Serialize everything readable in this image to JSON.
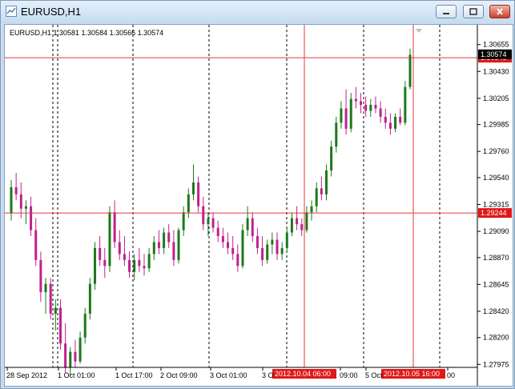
{
  "window": {
    "title": "EURUSD,H1",
    "minimize_icon": "minimize-icon",
    "maximize_icon": "maximize-icon",
    "close_icon": "close-icon"
  },
  "chart_data": {
    "type": "candlestick",
    "header": "EURUSD,H1  1.30581 1.30584 1.30566 1.30574",
    "y_range": [
      1.2795,
      1.307
    ],
    "y_ticks": [
      "1.30655",
      "1.30430",
      "1.30205",
      "1.29985",
      "1.29760",
      "1.29540",
      "1.29315",
      "1.29090",
      "1.28870",
      "1.28645",
      "1.28420",
      "1.28200",
      "1.27975"
    ],
    "x_labels": [
      "28 Sep 2012",
      "1 Oct 01:00",
      "1 Oct 17:00",
      "2 Oct 09:00",
      "3 Oct 01:00",
      "3 O",
      "09:00",
      "5 Oct",
      "00"
    ],
    "horizontal_lines": [
      {
        "price": 1.30545,
        "label": "1.30545"
      },
      {
        "price": 1.29244,
        "label": "1.29244"
      }
    ],
    "current_price": {
      "price": 1.30574,
      "label": "1.30574"
    },
    "vertical_lines": [
      {
        "label": "2012.10.04 06:00"
      },
      {
        "label": "2012.10.05 16:00"
      }
    ],
    "colors": {
      "bull": "#1a7a1a",
      "bear": "#c0208f",
      "line": "#e23a3a",
      "label_bg": "#e01818",
      "current_bg": "#000000"
    },
    "candles": [
      [
        1.2924,
        1.2952,
        1.2918,
        1.2946
      ],
      [
        1.2946,
        1.2958,
        1.2935,
        1.294
      ],
      [
        1.294,
        1.295,
        1.292,
        1.2928
      ],
      [
        1.2928,
        1.2935,
        1.2915,
        1.293
      ],
      [
        1.293,
        1.2938,
        1.2905,
        1.291
      ],
      [
        1.291,
        1.292,
        1.288,
        1.2885
      ],
      [
        1.2885,
        1.2892,
        1.285,
        1.2858
      ],
      [
        1.2858,
        1.287,
        1.284,
        1.2865
      ],
      [
        1.2865,
        1.287,
        1.2835,
        1.284
      ],
      [
        1.284,
        1.2852,
        1.2826,
        1.2845
      ],
      [
        1.2845,
        1.2852,
        1.281,
        1.2815
      ],
      [
        1.2815,
        1.2832,
        1.279,
        1.2795
      ],
      [
        1.2795,
        1.2812,
        1.2788,
        1.2808
      ],
      [
        1.2808,
        1.2818,
        1.2795,
        1.28
      ],
      [
        1.28,
        1.2825,
        1.2798,
        1.282
      ],
      [
        1.282,
        1.2845,
        1.2815,
        1.284
      ],
      [
        1.284,
        1.287,
        1.2835,
        1.2865
      ],
      [
        1.2865,
        1.29,
        1.286,
        1.2895
      ],
      [
        1.2895,
        1.2905,
        1.288,
        1.2885
      ],
      [
        1.2885,
        1.2895,
        1.287,
        1.288
      ],
      [
        1.288,
        1.293,
        1.2875,
        1.2925
      ],
      [
        1.2925,
        1.2935,
        1.2895,
        1.29
      ],
      [
        1.29,
        1.291,
        1.2885,
        1.289
      ],
      [
        1.289,
        1.2905,
        1.288,
        1.2885
      ],
      [
        1.2885,
        1.2892,
        1.287,
        1.2875
      ],
      [
        1.2875,
        1.289,
        1.2868,
        1.2885
      ],
      [
        1.2885,
        1.2895,
        1.2875,
        1.288
      ],
      [
        1.288,
        1.289,
        1.2872,
        1.2878
      ],
      [
        1.2878,
        1.2895,
        1.2875,
        1.289
      ],
      [
        1.289,
        1.2905,
        1.2885,
        1.29
      ],
      [
        1.29,
        1.291,
        1.289,
        1.2895
      ],
      [
        1.2895,
        1.2912,
        1.289,
        1.2908
      ],
      [
        1.2908,
        1.2915,
        1.2895,
        1.29
      ],
      [
        1.29,
        1.291,
        1.288,
        1.2885
      ],
      [
        1.2885,
        1.2912,
        1.2882,
        1.291
      ],
      [
        1.291,
        1.293,
        1.2905,
        1.2925
      ],
      [
        1.2925,
        1.2945,
        1.292,
        1.294
      ],
      [
        1.294,
        1.2965,
        1.2935,
        1.295
      ],
      [
        1.295,
        1.2955,
        1.2925,
        1.293
      ],
      [
        1.293,
        1.2938,
        1.291,
        1.2915
      ],
      [
        1.2915,
        1.2925,
        1.2905,
        1.292
      ],
      [
        1.292,
        1.2925,
        1.2908,
        1.2912
      ],
      [
        1.2912,
        1.2918,
        1.29,
        1.2905
      ],
      [
        1.2905,
        1.2912,
        1.2895,
        1.29
      ],
      [
        1.29,
        1.2908,
        1.289,
        1.2895
      ],
      [
        1.2895,
        1.2905,
        1.2885,
        1.289
      ],
      [
        1.289,
        1.2898,
        1.2875,
        1.288
      ],
      [
        1.288,
        1.2915,
        1.2878,
        1.291
      ],
      [
        1.291,
        1.293,
        1.2905,
        1.292
      ],
      [
        1.292,
        1.2925,
        1.29,
        1.2905
      ],
      [
        1.2905,
        1.2912,
        1.289,
        1.2895
      ],
      [
        1.2895,
        1.2905,
        1.288,
        1.2885
      ],
      [
        1.2885,
        1.2902,
        1.2882,
        1.2898
      ],
      [
        1.2898,
        1.2908,
        1.289,
        1.2902
      ],
      [
        1.2902,
        1.2908,
        1.2885,
        1.289
      ],
      [
        1.289,
        1.29,
        1.2885,
        1.2895
      ],
      [
        1.2895,
        1.2912,
        1.2892,
        1.2908
      ],
      [
        1.2908,
        1.2925,
        1.2905,
        1.292
      ],
      [
        1.292,
        1.293,
        1.291,
        1.2915
      ],
      [
        1.2915,
        1.292,
        1.2905,
        1.291
      ],
      [
        1.291,
        1.293,
        1.2908,
        1.2925
      ],
      [
        1.2925,
        1.2935,
        1.2918,
        1.293
      ],
      [
        1.293,
        1.295,
        1.2925,
        1.2945
      ],
      [
        1.2945,
        1.2955,
        1.2935,
        1.294
      ],
      [
        1.294,
        1.2965,
        1.2935,
        1.296
      ],
      [
        1.296,
        1.2985,
        1.2955,
        1.298
      ],
      [
        1.298,
        1.3005,
        1.2975,
        1.3
      ],
      [
        1.3,
        1.3018,
        1.2995,
        1.3012
      ],
      [
        1.3012,
        1.3028,
        1.299,
        1.2995
      ],
      [
        1.2995,
        1.3025,
        1.2992,
        1.302
      ],
      [
        1.302,
        1.303,
        1.3012,
        1.3018
      ],
      [
        1.3018,
        1.3025,
        1.3008,
        1.3015
      ],
      [
        1.3015,
        1.3022,
        1.3005,
        1.301
      ],
      [
        1.301,
        1.302,
        1.3005,
        1.3015
      ],
      [
        1.3015,
        1.3022,
        1.3008,
        1.3012
      ],
      [
        1.3012,
        1.3018,
        1.3,
        1.3005
      ],
      [
        1.3005,
        1.3012,
        1.2995,
        1.3
      ],
      [
        1.3,
        1.3008,
        1.299,
        1.2995
      ],
      [
        1.2995,
        1.3008,
        1.2992,
        1.3005
      ],
      [
        1.3005,
        1.3012,
        1.2998,
        1.3
      ],
      [
        1.3,
        1.3035,
        1.2998,
        1.303
      ],
      [
        1.303,
        1.3062,
        1.3028,
        1.3057
      ]
    ]
  }
}
